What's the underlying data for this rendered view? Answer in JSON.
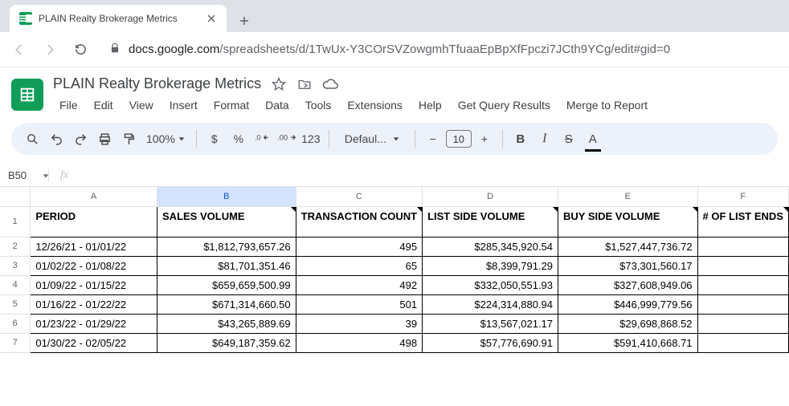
{
  "browser": {
    "tab_title": "PLAIN Realty Brokerage Metrics",
    "url_prefix": "docs.google.com",
    "url_path": "/spreadsheets/d/1TwUx-Y3COrSVZowgmhTfuaaEpBpXfFpczi7JCth9YCg/edit#gid=0"
  },
  "doc": {
    "title": "PLAIN Realty Brokerage Metrics",
    "menus": [
      "File",
      "Edit",
      "View",
      "Insert",
      "Format",
      "Data",
      "Tools",
      "Extensions",
      "Help",
      "Get Query Results",
      "Merge to Report"
    ]
  },
  "toolbar": {
    "zoom": "100%",
    "currency": "$",
    "percent": "%",
    "dec_dec": ".0↓",
    "dec_inc": ".00↑",
    "num_fmt": "123",
    "font": "Defaul...",
    "minus": "−",
    "size": "10",
    "plus": "+",
    "bold": "B",
    "italic": "I",
    "strike": "S",
    "color": "A"
  },
  "namebox": {
    "ref": "B50"
  },
  "columns": [
    "A",
    "B",
    "C",
    "D",
    "E",
    "F"
  ],
  "headers": {
    "A": "PERIOD",
    "B": "SALES VOLUME",
    "C": "TRANSACTION COUNT",
    "D": "LIST SIDE VOLUME",
    "E": "BUY SIDE VOLUME",
    "F": "# OF LIST ENDS"
  },
  "rows": [
    {
      "n": "2",
      "A": "12/26/21 - 01/01/22",
      "B": "$1,812,793,657.26",
      "C": "495",
      "D": "$285,345,920.54",
      "E": "$1,527,447,736.72"
    },
    {
      "n": "3",
      "A": "01/02/22 - 01/08/22",
      "B": "$81,701,351.46",
      "C": "65",
      "D": "$8,399,791.29",
      "E": "$73,301,560.17"
    },
    {
      "n": "4",
      "A": "01/09/22 - 01/15/22",
      "B": "$659,659,500.99",
      "C": "492",
      "D": "$332,050,551.93",
      "E": "$327,608,949.06"
    },
    {
      "n": "5",
      "A": "01/16/22 - 01/22/22",
      "B": "$671,314,660.50",
      "C": "501",
      "D": "$224,314,880.94",
      "E": "$446,999,779.56"
    },
    {
      "n": "6",
      "A": "01/23/22 - 01/29/22",
      "B": "$43,265,889.69",
      "C": "39",
      "D": "$13,567,021.17",
      "E": "$29,698,868.52"
    },
    {
      "n": "7",
      "A": "01/30/22 - 02/05/22",
      "B": "$649,187,359.62",
      "C": "498",
      "D": "$57,776,690.91",
      "E": "$591,410,668.71"
    }
  ]
}
